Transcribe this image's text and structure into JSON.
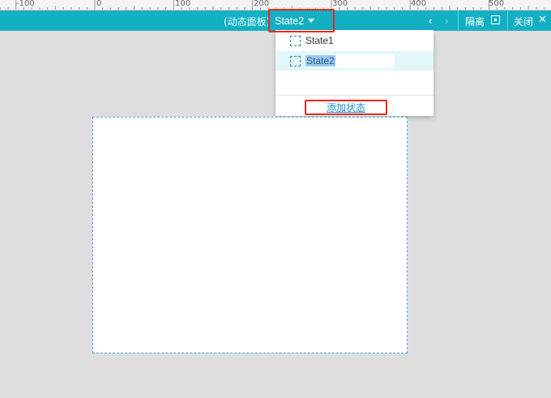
{
  "ruler": {
    "labels": [
      "-100",
      "0",
      "100",
      "200",
      "300",
      "400",
      "500"
    ]
  },
  "toolbar": {
    "panel_name": "(动态面板)",
    "current_state": "State2",
    "prev_icon": "chevron-left-icon",
    "next_icon": "chevron-right-icon",
    "isolate_label": "隔离",
    "isolate_icon": "isolate-icon",
    "close_label": "关闭",
    "close_icon": "close-icon"
  },
  "state_dropdown": {
    "items": [
      {
        "label": "State1",
        "icon": "state-icon"
      },
      {
        "label": "State2",
        "icon": "state-icon",
        "selected": true,
        "editing": true
      }
    ],
    "add_label": "添加状态"
  },
  "colors": {
    "toolbar": "#13b0c4",
    "highlight": "#e8281c",
    "selected_row": "#e2f7fa",
    "link": "#1f8dd6",
    "canvas_border": "#43a7d8",
    "background": "#dedede"
  }
}
